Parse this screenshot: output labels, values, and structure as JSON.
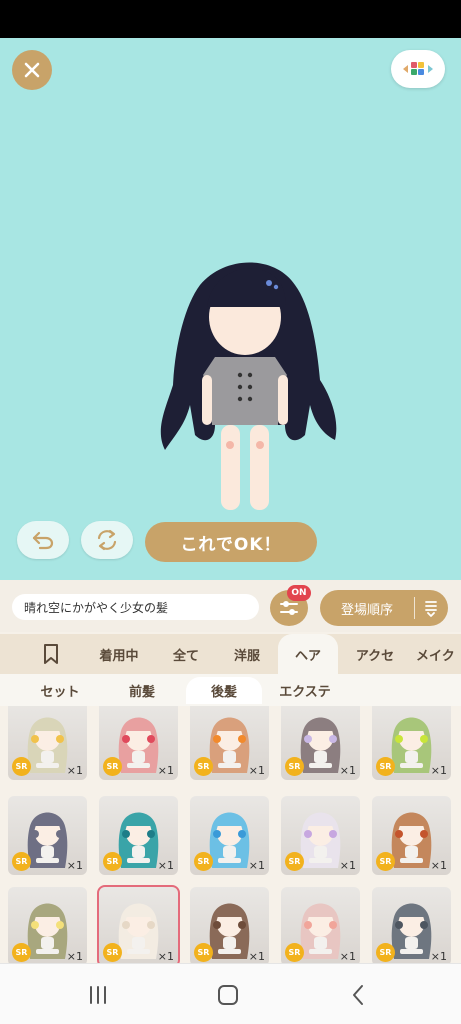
{
  "ok_button": "これでOK！",
  "item_title": "晴れ空にかがやく少女の髪",
  "filter_badge": "ON",
  "sort_label": "登場順序",
  "tabs": [
    "着用中",
    "全て",
    "洋服",
    "ヘア",
    "アクセ",
    "メイク"
  ],
  "active_tab": "ヘア",
  "subtabs": [
    "セット",
    "前髪",
    "後髪",
    "エクステ"
  ],
  "active_subtab": "後髪",
  "items": [
    {
      "rarity": "SR",
      "qty": "×1",
      "hair": "#d9d5b8",
      "accent": "#f1c24b"
    },
    {
      "rarity": "SR",
      "qty": "×1",
      "hair": "#e8a0a0",
      "accent": "#e04a5c"
    },
    {
      "rarity": "SR",
      "qty": "×1",
      "hair": "#d9a07c",
      "accent": "#f28a2c"
    },
    {
      "rarity": "SR",
      "qty": "×1",
      "hair": "#8c7e80",
      "accent": "#c9b8e5"
    },
    {
      "rarity": "SR",
      "qty": "×1",
      "hair": "#a8c67a",
      "accent": "#c9e53a"
    },
    {
      "rarity": "SR",
      "qty": "×1",
      "hair": "#6e6f84",
      "accent": "#6e6f84"
    },
    {
      "rarity": "SR",
      "qty": "×1",
      "hair": "#3aa4a8",
      "accent": "#1e7d88"
    },
    {
      "rarity": "SR",
      "qty": "×1",
      "hair": "#6cc0e5",
      "accent": "#3a9ad8"
    },
    {
      "rarity": "SR",
      "qty": "×1",
      "hair": "#e9e3ec",
      "accent": "#c7a7e0"
    },
    {
      "rarity": "SR",
      "qty": "×1",
      "hair": "#c4875c",
      "accent": "#c4542c"
    },
    {
      "rarity": "SR",
      "qty": "×1",
      "hair": "#a8a77e",
      "accent": "#f4e07a"
    },
    {
      "rarity": "SR",
      "qty": "×1",
      "hair": "#f3ece2",
      "accent": "#e6d8c6"
    },
    {
      "rarity": "SR",
      "qty": "×1",
      "hair": "#8a6a58",
      "accent": "#6e4c3a"
    },
    {
      "rarity": "SR",
      "qty": "×1",
      "hair": "#e8c6c2",
      "accent": "#f1a59a"
    },
    {
      "rarity": "SR",
      "qty": "×1",
      "hair": "#6e7680",
      "accent": "#4e5660"
    }
  ],
  "colors": {
    "stage_bg": "#a8e6e3",
    "accent_gold": "#c8a369",
    "badge_red": "#e2444e",
    "sr_yellow": "#f2b21d",
    "selected_border": "#e46b7b"
  }
}
